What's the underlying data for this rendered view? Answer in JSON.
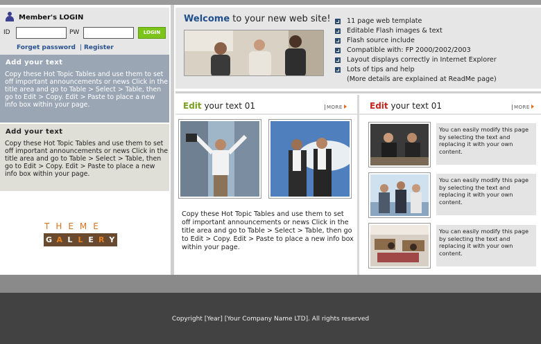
{
  "login": {
    "title": "Member's LOGIN",
    "id_label": "ID",
    "pw_label": "PW",
    "button_label": "LOGIN",
    "forget_link": "Forget password",
    "register_link": "Register"
  },
  "left_boxes": [
    {
      "title": "Add your text",
      "text": "Copy these Hot Topic Tables and use them to set off important announcements or news Click in the title area and go to Table > Select > Table, then go to Edit > Copy. Edit > Paste to place a new info box within your page."
    },
    {
      "title": "Add your text",
      "text": "Copy these Hot Topic Tables and use them to set off important announcements or news Click in the title area and go to Table > Select > Table, then go to Edit > Copy. Edit > Paste to place a new info box within your page."
    }
  ],
  "logo": {
    "top": "THEME",
    "letters": [
      "G",
      "A",
      "L",
      "L",
      "E",
      "R",
      "Y"
    ]
  },
  "welcome": {
    "title_accent": "Welcome",
    "title_rest": " to your new web site!",
    "features": [
      "11 page web template",
      "Editable Flash images & text",
      "Flash source include",
      "Compatible with: FP 2000/2002/2003",
      "Layout displays correctly in Internet Explorer",
      "Lots of tips and help",
      "(More details are explained at ReadMe page)"
    ]
  },
  "middle": {
    "header_accent": "Edit",
    "header_rest": " your text 01",
    "more": "MORE",
    "text": "Copy these Hot Topic Tables and use them to set off important announcements or news Click in the title area and go to Table > Select > Table, then go to Edit > Copy. Edit > Paste to place a new info box within your page."
  },
  "right": {
    "header_accent": "Edit",
    "header_rest": " your text 01",
    "more": "MORE",
    "notes": [
      "You can easily modify this page by selecting the text and replacing it with your own content.",
      "You can easily modify this page by selecting the text and replacing it with your own content.",
      "You can easily modify this page by selecting the text and replacing it with your own content."
    ]
  },
  "footer": {
    "text": "Copyright   [Year] [Your Company Name LTD]. All rights reserved"
  },
  "colors": {
    "welcome_accent": "#1d4f8c",
    "edit_green": "#77a11e",
    "edit_red": "#c4241a",
    "login_button": "#7cc41a",
    "footer_bg": "#424242"
  }
}
